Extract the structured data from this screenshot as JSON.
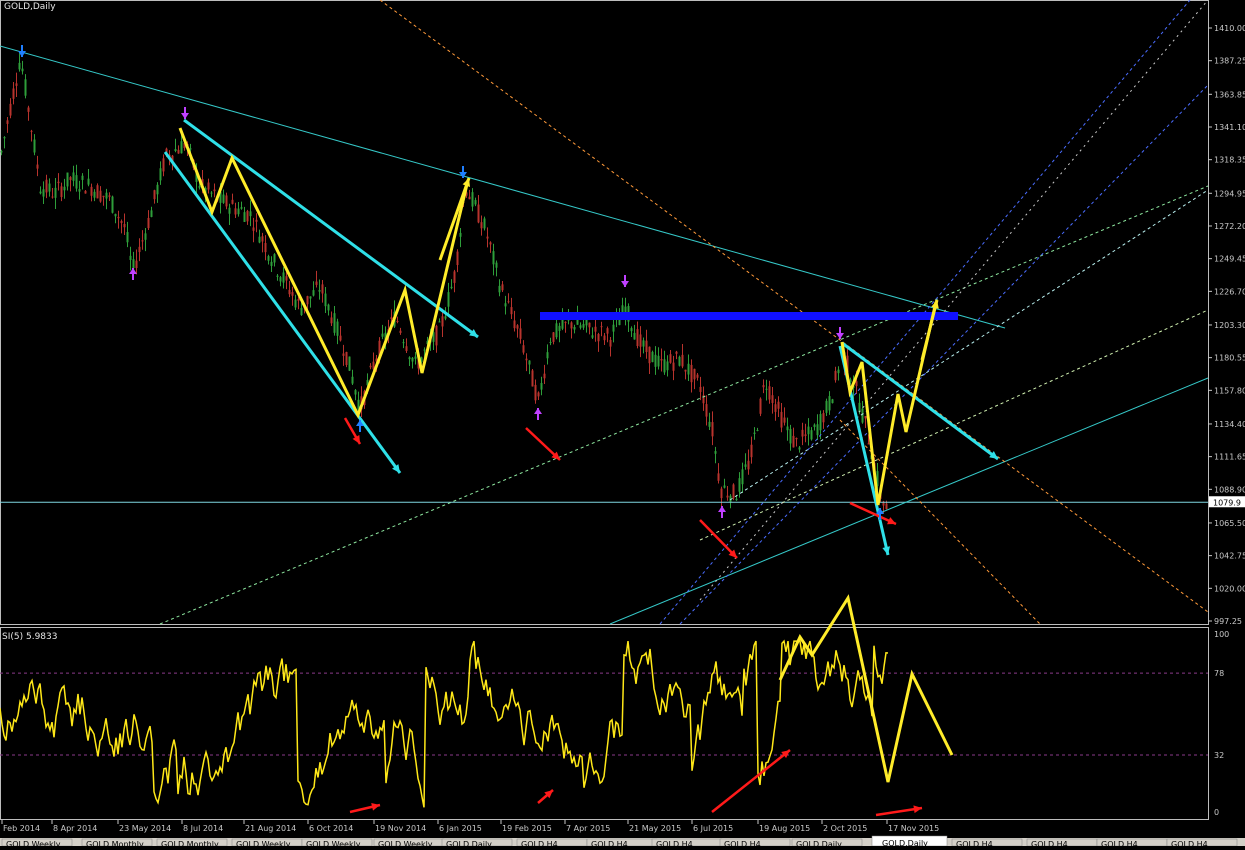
{
  "chart_data": [
    {
      "type": "candlestick",
      "title": "GOLD,Daily",
      "ylim": [
        990,
        1420
      ],
      "y_ticks": [
        "1410.00",
        "1387.25",
        "1363.85",
        "1341.10",
        "1318.35",
        "1294.95",
        "1272.20",
        "1249.45",
        "1226.70",
        "1203.30",
        "1180.55",
        "1157.80",
        "1134.40",
        "1111.65",
        "1088.90",
        "1065.50",
        "1042.75",
        "1020.00",
        "997.25"
      ],
      "current_price": "1079.9",
      "x_ticks": [
        "Feb 2014",
        "8 Apr 2014",
        "23 May 2014",
        "8 Jul 2014",
        "21 Aug 2014",
        "6 Oct 2014",
        "19 Nov 2014",
        "6 Jan 2015",
        "19 Feb 2015",
        "7 Apr 2015",
        "21 May 2015",
        "6 Jul 2015",
        "19 Aug 2015",
        "2 Oct 2015",
        "17 Nov 2015"
      ],
      "colors": {
        "bull": "#2e9e3a",
        "bear": "#b8332d",
        "cyan": "#2fe0e8",
        "yellow": "#ffec2a",
        "blue_zone": "#1010ff",
        "red_arrow": "#ff1a1a",
        "axis": "#c8c8c8"
      }
    },
    {
      "type": "line",
      "title": "SI(5) 5.9833",
      "ylim": [
        0,
        100
      ],
      "y_ticks": [
        "100",
        "78",
        "32",
        "0"
      ],
      "levels": [
        78,
        32
      ],
      "colors": {
        "line": "#ffe818",
        "level": "#8a3a8a"
      }
    }
  ],
  "tabs": [
    "GOLD,Weekly",
    "GOLD,Monthly",
    "GOLD,Monthly",
    "GOLD,Weekly",
    "GOLD,Weekly",
    "GOLD,Weekly",
    "GOLD,Daily",
    "GOLD,H4",
    "GOLD,H4",
    "GOLD,H4",
    "GOLD,H4",
    "GOLD,Daily",
    "GOLD,H4",
    "GOLD,H4",
    "GOLD,H4",
    "GOLD,H4"
  ],
  "active_tab": "GOLD,Daily"
}
